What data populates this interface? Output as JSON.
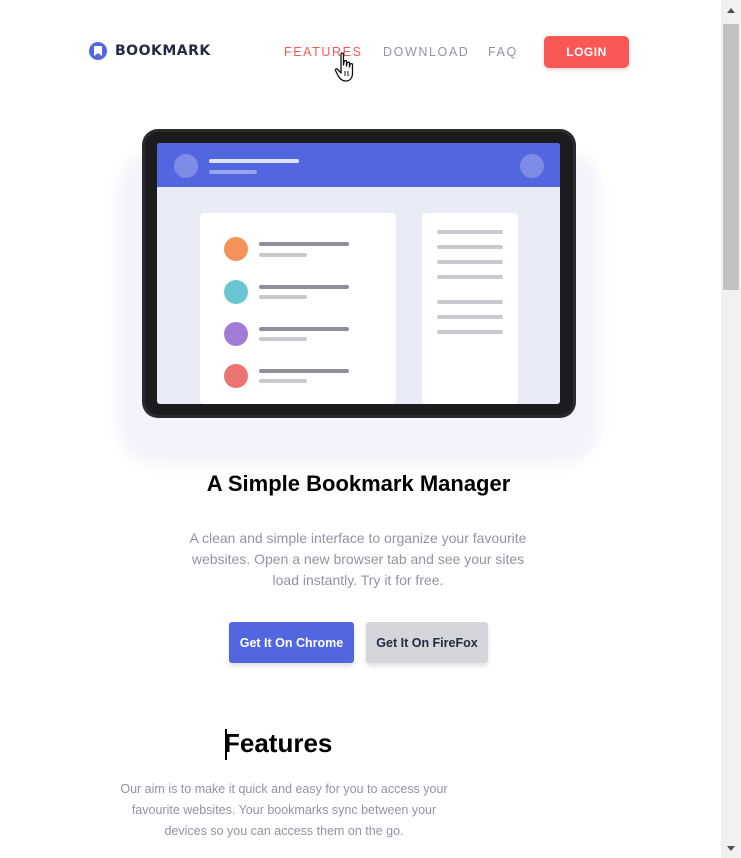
{
  "header": {
    "logo_text": "BOOKMARK",
    "nav": [
      {
        "label": "FEATURES",
        "active": true
      },
      {
        "label": "DOWNLOAD",
        "active": false
      },
      {
        "label": "FAQ",
        "active": false
      }
    ],
    "login_label": "LOGIN"
  },
  "hero": {
    "title": "A Simple Bookmark Manager",
    "description": "A clean and simple interface to organize your favourite websites. Open a new browser tab and see your sites load instantly. Try it for free.",
    "chrome_button": "Get It On Chrome",
    "firefox_button": "Get It On FireFox"
  },
  "features": {
    "title": "Features",
    "description": "Our aim is to make it quick and easy for you to access your favourite websites. Your bookmarks sync between your devices so you can access them on the go."
  },
  "colors": {
    "accent_red": "#fa5757",
    "accent_blue": "#5267df",
    "text_dark": "#242a45",
    "text_muted": "#9194a2"
  },
  "illustration_dot_colors": [
    "#f4925a",
    "#6ac6d3",
    "#a27bd6",
    "#ea7474"
  ]
}
